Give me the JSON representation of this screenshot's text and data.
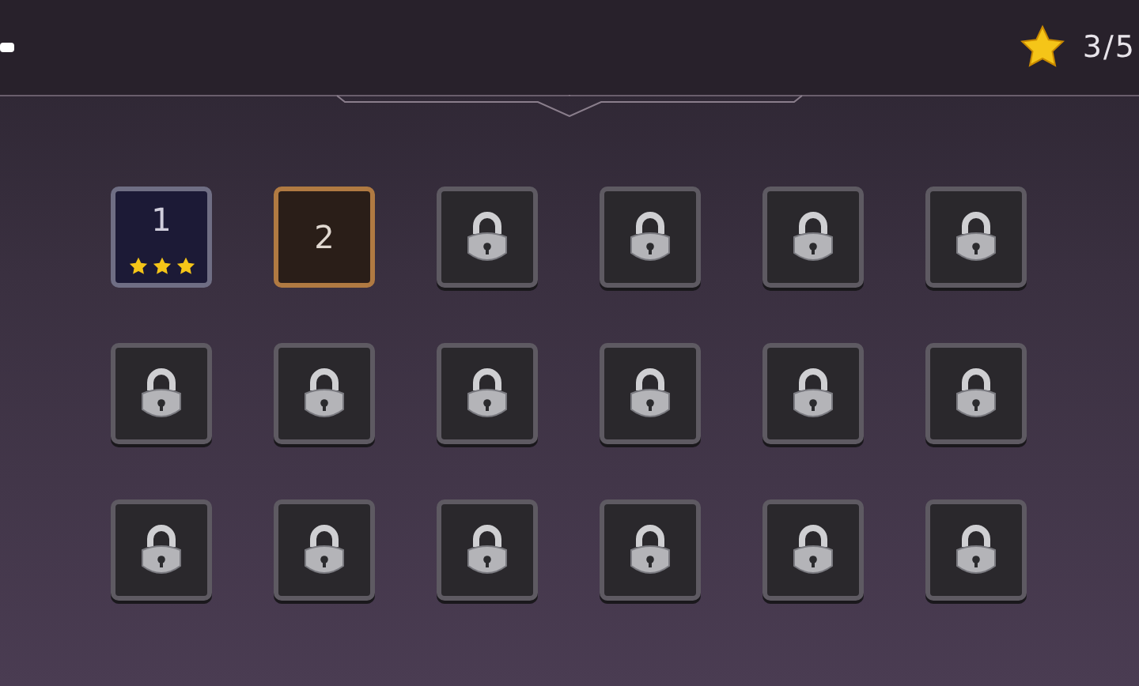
{
  "header": {
    "star_count": "3/5"
  },
  "levels": [
    {
      "kind": "completed",
      "label": "1",
      "stars": 3
    },
    {
      "kind": "current",
      "label": "2"
    },
    {
      "kind": "locked"
    },
    {
      "kind": "locked"
    },
    {
      "kind": "locked"
    },
    {
      "kind": "locked"
    },
    {
      "kind": "locked"
    },
    {
      "kind": "locked"
    },
    {
      "kind": "locked"
    },
    {
      "kind": "locked"
    },
    {
      "kind": "locked"
    },
    {
      "kind": "locked"
    },
    {
      "kind": "locked"
    },
    {
      "kind": "locked"
    },
    {
      "kind": "locked"
    },
    {
      "kind": "locked"
    },
    {
      "kind": "locked"
    },
    {
      "kind": "locked"
    }
  ]
}
